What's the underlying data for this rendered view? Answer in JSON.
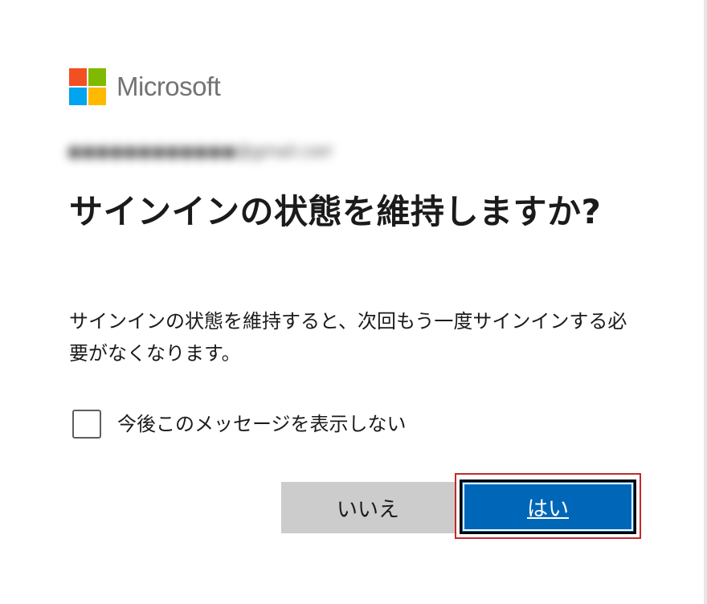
{
  "logo": {
    "brand_name": "Microsoft",
    "colors": [
      "#f25022",
      "#7fba00",
      "#00a4ef",
      "#ffb900"
    ]
  },
  "account": {
    "email": "●●●●●●●●●●●●@gmail.com"
  },
  "dialog": {
    "title": "サインインの状態を維持しますか?",
    "description": "サインインの状態を維持すると、次回もう一度サインインする必要がなくなります。",
    "checkbox_label": "今後このメッセージを表示しない",
    "no_button": "いいえ",
    "yes_button": "はい"
  },
  "colors": {
    "primary": "#0067b8",
    "secondary": "#cccccc",
    "focus_outline": "#c62828"
  }
}
